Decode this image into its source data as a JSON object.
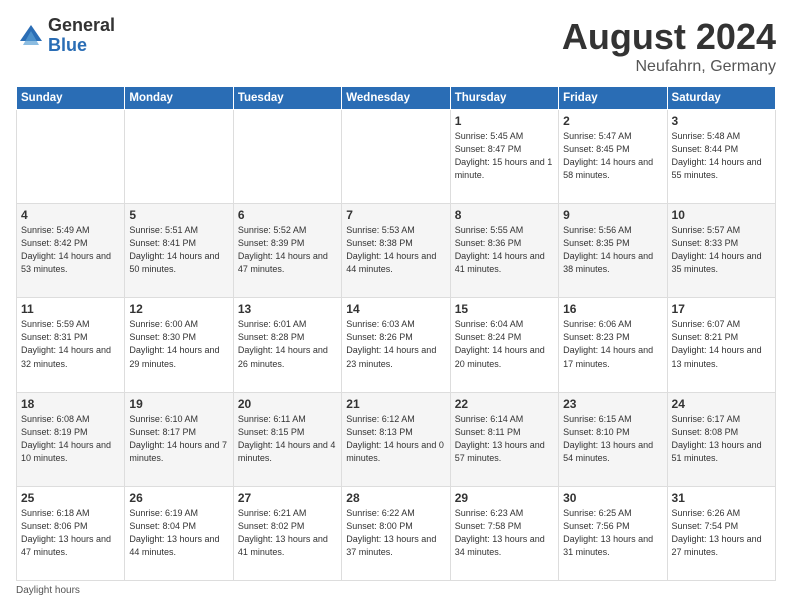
{
  "header": {
    "logo_general": "General",
    "logo_blue": "Blue",
    "month_year": "August 2024",
    "location": "Neufahrn, Germany"
  },
  "weekdays": [
    "Sunday",
    "Monday",
    "Tuesday",
    "Wednesday",
    "Thursday",
    "Friday",
    "Saturday"
  ],
  "weeks": [
    [
      {
        "day": "",
        "info": ""
      },
      {
        "day": "",
        "info": ""
      },
      {
        "day": "",
        "info": ""
      },
      {
        "day": "",
        "info": ""
      },
      {
        "day": "1",
        "info": "Sunrise: 5:45 AM\nSunset: 8:47 PM\nDaylight: 15 hours\nand 1 minute."
      },
      {
        "day": "2",
        "info": "Sunrise: 5:47 AM\nSunset: 8:45 PM\nDaylight: 14 hours\nand 58 minutes."
      },
      {
        "day": "3",
        "info": "Sunrise: 5:48 AM\nSunset: 8:44 PM\nDaylight: 14 hours\nand 55 minutes."
      }
    ],
    [
      {
        "day": "4",
        "info": "Sunrise: 5:49 AM\nSunset: 8:42 PM\nDaylight: 14 hours\nand 53 minutes."
      },
      {
        "day": "5",
        "info": "Sunrise: 5:51 AM\nSunset: 8:41 PM\nDaylight: 14 hours\nand 50 minutes."
      },
      {
        "day": "6",
        "info": "Sunrise: 5:52 AM\nSunset: 8:39 PM\nDaylight: 14 hours\nand 47 minutes."
      },
      {
        "day": "7",
        "info": "Sunrise: 5:53 AM\nSunset: 8:38 PM\nDaylight: 14 hours\nand 44 minutes."
      },
      {
        "day": "8",
        "info": "Sunrise: 5:55 AM\nSunset: 8:36 PM\nDaylight: 14 hours\nand 41 minutes."
      },
      {
        "day": "9",
        "info": "Sunrise: 5:56 AM\nSunset: 8:35 PM\nDaylight: 14 hours\nand 38 minutes."
      },
      {
        "day": "10",
        "info": "Sunrise: 5:57 AM\nSunset: 8:33 PM\nDaylight: 14 hours\nand 35 minutes."
      }
    ],
    [
      {
        "day": "11",
        "info": "Sunrise: 5:59 AM\nSunset: 8:31 PM\nDaylight: 14 hours\nand 32 minutes."
      },
      {
        "day": "12",
        "info": "Sunrise: 6:00 AM\nSunset: 8:30 PM\nDaylight: 14 hours\nand 29 minutes."
      },
      {
        "day": "13",
        "info": "Sunrise: 6:01 AM\nSunset: 8:28 PM\nDaylight: 14 hours\nand 26 minutes."
      },
      {
        "day": "14",
        "info": "Sunrise: 6:03 AM\nSunset: 8:26 PM\nDaylight: 14 hours\nand 23 minutes."
      },
      {
        "day": "15",
        "info": "Sunrise: 6:04 AM\nSunset: 8:24 PM\nDaylight: 14 hours\nand 20 minutes."
      },
      {
        "day": "16",
        "info": "Sunrise: 6:06 AM\nSunset: 8:23 PM\nDaylight: 14 hours\nand 17 minutes."
      },
      {
        "day": "17",
        "info": "Sunrise: 6:07 AM\nSunset: 8:21 PM\nDaylight: 14 hours\nand 13 minutes."
      }
    ],
    [
      {
        "day": "18",
        "info": "Sunrise: 6:08 AM\nSunset: 8:19 PM\nDaylight: 14 hours\nand 10 minutes."
      },
      {
        "day": "19",
        "info": "Sunrise: 6:10 AM\nSunset: 8:17 PM\nDaylight: 14 hours\nand 7 minutes."
      },
      {
        "day": "20",
        "info": "Sunrise: 6:11 AM\nSunset: 8:15 PM\nDaylight: 14 hours\nand 4 minutes."
      },
      {
        "day": "21",
        "info": "Sunrise: 6:12 AM\nSunset: 8:13 PM\nDaylight: 14 hours\nand 0 minutes."
      },
      {
        "day": "22",
        "info": "Sunrise: 6:14 AM\nSunset: 8:11 PM\nDaylight: 13 hours\nand 57 minutes."
      },
      {
        "day": "23",
        "info": "Sunrise: 6:15 AM\nSunset: 8:10 PM\nDaylight: 13 hours\nand 54 minutes."
      },
      {
        "day": "24",
        "info": "Sunrise: 6:17 AM\nSunset: 8:08 PM\nDaylight: 13 hours\nand 51 minutes."
      }
    ],
    [
      {
        "day": "25",
        "info": "Sunrise: 6:18 AM\nSunset: 8:06 PM\nDaylight: 13 hours\nand 47 minutes."
      },
      {
        "day": "26",
        "info": "Sunrise: 6:19 AM\nSunset: 8:04 PM\nDaylight: 13 hours\nand 44 minutes."
      },
      {
        "day": "27",
        "info": "Sunrise: 6:21 AM\nSunset: 8:02 PM\nDaylight: 13 hours\nand 41 minutes."
      },
      {
        "day": "28",
        "info": "Sunrise: 6:22 AM\nSunset: 8:00 PM\nDaylight: 13 hours\nand 37 minutes."
      },
      {
        "day": "29",
        "info": "Sunrise: 6:23 AM\nSunset: 7:58 PM\nDaylight: 13 hours\nand 34 minutes."
      },
      {
        "day": "30",
        "info": "Sunrise: 6:25 AM\nSunset: 7:56 PM\nDaylight: 13 hours\nand 31 minutes."
      },
      {
        "day": "31",
        "info": "Sunrise: 6:26 AM\nSunset: 7:54 PM\nDaylight: 13 hours\nand 27 minutes."
      }
    ]
  ],
  "footer": "Daylight hours"
}
